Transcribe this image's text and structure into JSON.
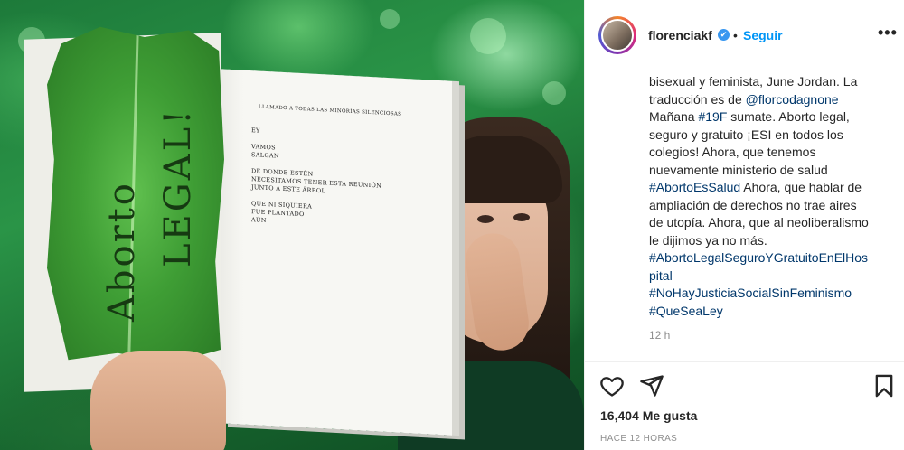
{
  "post": {
    "username": "florenciakf",
    "verified_mark": "✔",
    "separator": "•",
    "follow_label": "Seguir",
    "more_label": "•••",
    "caption_lines": [
      [
        {
          "t": "bisexual y feminista, June Jordan. La"
        }
      ],
      [
        {
          "t": "traducción es de "
        },
        {
          "t": "@florcodagnone",
          "link": true
        }
      ],
      [
        {
          "t": "Mañana "
        },
        {
          "t": "#19F",
          "link": true
        },
        {
          "t": " sumate. Aborto legal,"
        }
      ],
      [
        {
          "t": "seguro y gratuito ¡ESI en todos los"
        }
      ],
      [
        {
          "t": "colegios! Ahora, que tenemos"
        }
      ],
      [
        {
          "t": "nuevamente ministerio de salud"
        }
      ],
      [
        {
          "t": "#AbortoEsSalud",
          "link": true
        },
        {
          "t": " Ahora, que hablar de"
        }
      ],
      [
        {
          "t": "ampliación de derechos no trae aires"
        }
      ],
      [
        {
          "t": "de utopía. Ahora, que al neoliberalismo"
        }
      ],
      [
        {
          "t": "le dijimos ya no más."
        }
      ],
      [
        {
          "t": "#AbortoLegalSeguroYGratuitoEnElHos",
          "link": true
        }
      ],
      [
        {
          "t": "pital",
          "link": true
        }
      ],
      [
        {
          "t": "#NoHayJusticiaSocialSinFeminismo",
          "link": true
        }
      ],
      [
        {
          "t": "#QueSeaLey",
          "link": true
        }
      ]
    ],
    "comment_time": "12 h",
    "likes_label": "16,404 Me gusta",
    "posted_ago": "HACE 12 HORAS"
  },
  "photo": {
    "leaf_text_1": "Aborto",
    "leaf_text_2": "LEGAL!",
    "poem_title": "LLAMADO A TODAS LAS MINORÍAS SILENCIOSAS",
    "poem_lines": [
      "EY",
      "",
      "VAMOS",
      "SALGAN",
      "",
      "DE DONDE ESTÉN",
      "NECESITAMOS TENER ESTA REUNIÓN",
      "JUNTO A ESTE ÁRBOL",
      "",
      "QUE NI SIQUIERA",
      "FUE PLANTADO",
      "AÚN"
    ]
  },
  "icons": [
    "like-heart-icon",
    "share-send-icon",
    "save-bookmark-icon",
    "more-options-icon",
    "verified-badge-icon"
  ],
  "colors": {
    "link": "#00376b",
    "follow": "#0095f6",
    "verified": "#3897f0",
    "muted": "#8e8e8e"
  }
}
